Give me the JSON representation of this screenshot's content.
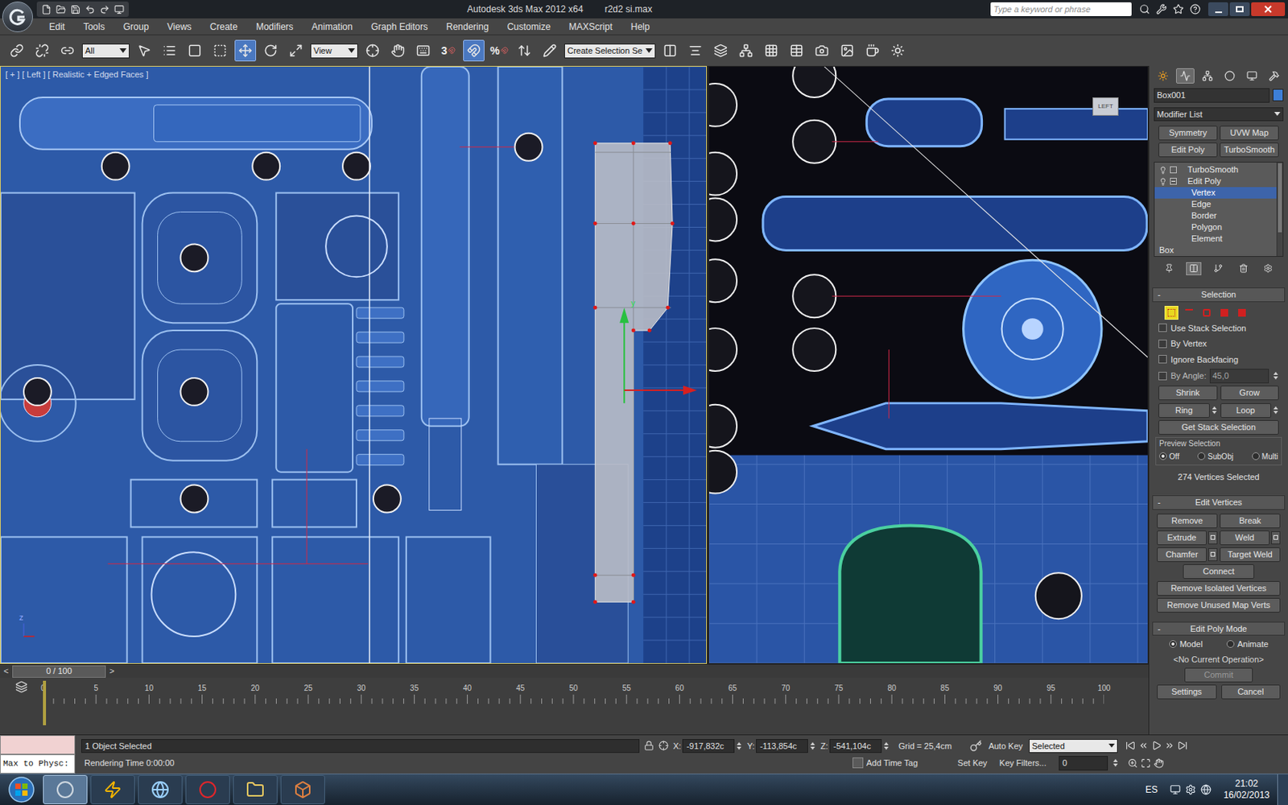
{
  "window": {
    "title": "Autodesk 3ds Max  2012 x64",
    "file": "r2d2 si.max",
    "search_placeholder": "Type a keyword or phrase"
  },
  "menu": [
    "Edit",
    "Tools",
    "Group",
    "Views",
    "Create",
    "Modifiers",
    "Animation",
    "Graph Editors",
    "Rendering",
    "Customize",
    "MAXScript",
    "Help"
  ],
  "toolbar": [
    {
      "kind": "icon",
      "selected": false
    },
    {
      "kind": "icon",
      "selected": false
    },
    {
      "kind": "icon",
      "selected": false
    },
    {
      "kind": "dropdown",
      "label": "All"
    },
    {
      "kind": "icon",
      "selected": false
    },
    {
      "kind": "icon",
      "selected": false
    },
    {
      "kind": "icon",
      "selected": false
    },
    {
      "kind": "icon",
      "selected": false
    },
    {
      "kind": "icon",
      "selected": true
    },
    {
      "kind": "icon",
      "selected": false
    },
    {
      "kind": "icon",
      "selected": false
    },
    {
      "kind": "dropdown",
      "label": "View"
    },
    {
      "kind": "icon",
      "selected": false
    },
    {
      "kind": "icon",
      "selected": false
    },
    {
      "kind": "icon",
      "selected": false
    },
    {
      "kind": "snap",
      "label": "3",
      "selected": false
    },
    {
      "kind": "icon",
      "selected": true
    },
    {
      "kind": "snap",
      "label": "%",
      "selected": false
    },
    {
      "kind": "icon",
      "selected": false
    },
    {
      "kind": "icon",
      "selected": false
    },
    {
      "kind": "dropdown",
      "label": "Create Selection Se"
    },
    {
      "kind": "icon",
      "selected": false
    },
    {
      "kind": "icon",
      "selected": false
    },
    {
      "kind": "icon",
      "selected": false
    },
    {
      "kind": "icon",
      "selected": false
    },
    {
      "kind": "icon",
      "selected": false
    },
    {
      "kind": "icon",
      "selected": false
    },
    {
      "kind": "icon",
      "selected": false
    },
    {
      "kind": "icon",
      "selected": false
    },
    {
      "kind": "icon",
      "selected": false
    },
    {
      "kind": "icon",
      "selected": false
    }
  ],
  "viewports": {
    "left": {
      "label": "[ + ] [ Left ] [ Realistic + Edged Faces ]",
      "active": true,
      "gizmo_axis": "y",
      "corner_axis": "z"
    },
    "right": {
      "viewcube": "LEFT"
    }
  },
  "command_panel": {
    "tabs": [
      {
        "selected": false
      },
      {
        "selected": true
      },
      {
        "selected": false
      },
      {
        "selected": false
      },
      {
        "selected": false
      },
      {
        "selected": false
      }
    ],
    "object_name": "Box001",
    "object_color": "#3d7fd8",
    "modifier_list": "Modifier List",
    "modifier_buttons": [
      "Symmetry",
      "UVW Map",
      "Edit Poly",
      "TurboSmooth"
    ],
    "stack": [
      {
        "label": "TurboSmooth",
        "kind": "modifier",
        "selected": false,
        "expanded": false
      },
      {
        "label": "Edit Poly",
        "kind": "modifier",
        "selected": false,
        "expanded": true
      },
      {
        "label": "Vertex",
        "kind": "subobject",
        "selected": true,
        "expanded": false
      },
      {
        "label": "Edge",
        "kind": "subobject",
        "selected": false,
        "expanded": false
      },
      {
        "label": "Border",
        "kind": "subobject",
        "selected": false,
        "expanded": false
      },
      {
        "label": "Polygon",
        "kind": "subobject",
        "selected": false,
        "expanded": false
      },
      {
        "label": "Element",
        "kind": "subobject",
        "selected": false,
        "expanded": false
      },
      {
        "label": "Box",
        "kind": "base",
        "selected": false,
        "expanded": false
      }
    ],
    "stack_tools": [
      {
        "selected": false
      },
      {
        "selected": true
      },
      {
        "selected": false
      },
      {
        "selected": false
      },
      {
        "selected": false
      }
    ],
    "selection": {
      "title": "Selection",
      "toggle": "-",
      "subobjects": [
        {
          "selected": true
        },
        {
          "selected": false
        },
        {
          "selected": false
        },
        {
          "selected": false
        },
        {
          "selected": false
        }
      ],
      "checkboxes": [
        {
          "label": "Use Stack Selection",
          "checked": false
        },
        {
          "label": "By Vertex",
          "checked": false
        },
        {
          "label": "Ignore Backfacing",
          "checked": false
        }
      ],
      "by_angle": {
        "label": "By Angle:",
        "checked": false,
        "value": "45,0"
      },
      "shrink": "Shrink",
      "grow": "Grow",
      "ring": "Ring",
      "loop": "Loop",
      "get_stack": "Get Stack Selection",
      "preview": {
        "label": "Preview Selection",
        "options": [
          {
            "label": "Off",
            "selected": true
          },
          {
            "label": "SubObj",
            "selected": false
          },
          {
            "label": "Multi",
            "selected": false
          }
        ]
      },
      "count": "274 Vertices Selected"
    },
    "edit_vertices": {
      "title": "Edit Vertices",
      "toggle": "-",
      "buttons": [
        {
          "label": "Remove",
          "settings": false
        },
        {
          "label": "Break",
          "settings": false
        },
        {
          "label": "Extrude",
          "settings": true
        },
        {
          "label": "Weld",
          "settings": true
        },
        {
          "label": "Chamfer",
          "settings": true
        },
        {
          "label": "Target Weld",
          "settings": false
        }
      ],
      "wide_buttons": [
        "Connect",
        "Remove Isolated Vertices",
        "Remove Unused Map Verts"
      ]
    },
    "edit_poly_mode": {
      "title": "Edit Poly Mode",
      "toggle": "-",
      "modes": [
        {
          "label": "Model",
          "selected": true
        },
        {
          "label": "Animate",
          "selected": false
        }
      ],
      "operation": "<No Current Operation>",
      "commit": {
        "label": "Commit",
        "disabled": true
      },
      "settings": {
        "label": "Settings",
        "disabled": false
      },
      "cancel": {
        "label": "Cancel",
        "disabled": false
      }
    }
  },
  "timeline": {
    "frame": "0 / 100",
    "prev": "<",
    "next": ">",
    "level": 0,
    "ticks": [
      "0",
      "5",
      "10",
      "15",
      "20",
      "25",
      "30",
      "35",
      "40",
      "45",
      "50",
      "55",
      "60",
      "65",
      "70",
      "75",
      "80",
      "85",
      "90",
      "95",
      "100"
    ]
  },
  "status_bar": {
    "listener": "Max to Physc:",
    "prompt": "1 Object Selected",
    "info": "Rendering Time  0:00:00",
    "coords": [
      {
        "axis": "X:",
        "value": "-917,832c"
      },
      {
        "axis": "Y:",
        "value": "-113,854c"
      },
      {
        "axis": "Z:",
        "value": "-541,104c"
      }
    ],
    "grid": "Grid = 25,4cm",
    "add_time_tag": "Add Time Tag",
    "auto_key": "Auto Key",
    "set_key": "Set Key",
    "key_mode": "Selected",
    "key_filters": "Key Filters...",
    "current_frame": "0"
  },
  "taskbar": {
    "apps": [
      {
        "selected": true
      },
      {
        "selected": false
      },
      {
        "selected": false
      },
      {
        "selected": false
      },
      {
        "selected": false
      },
      {
        "selected": false
      }
    ],
    "language": "ES",
    "time": "21:02",
    "date": "16/02/2013"
  }
}
